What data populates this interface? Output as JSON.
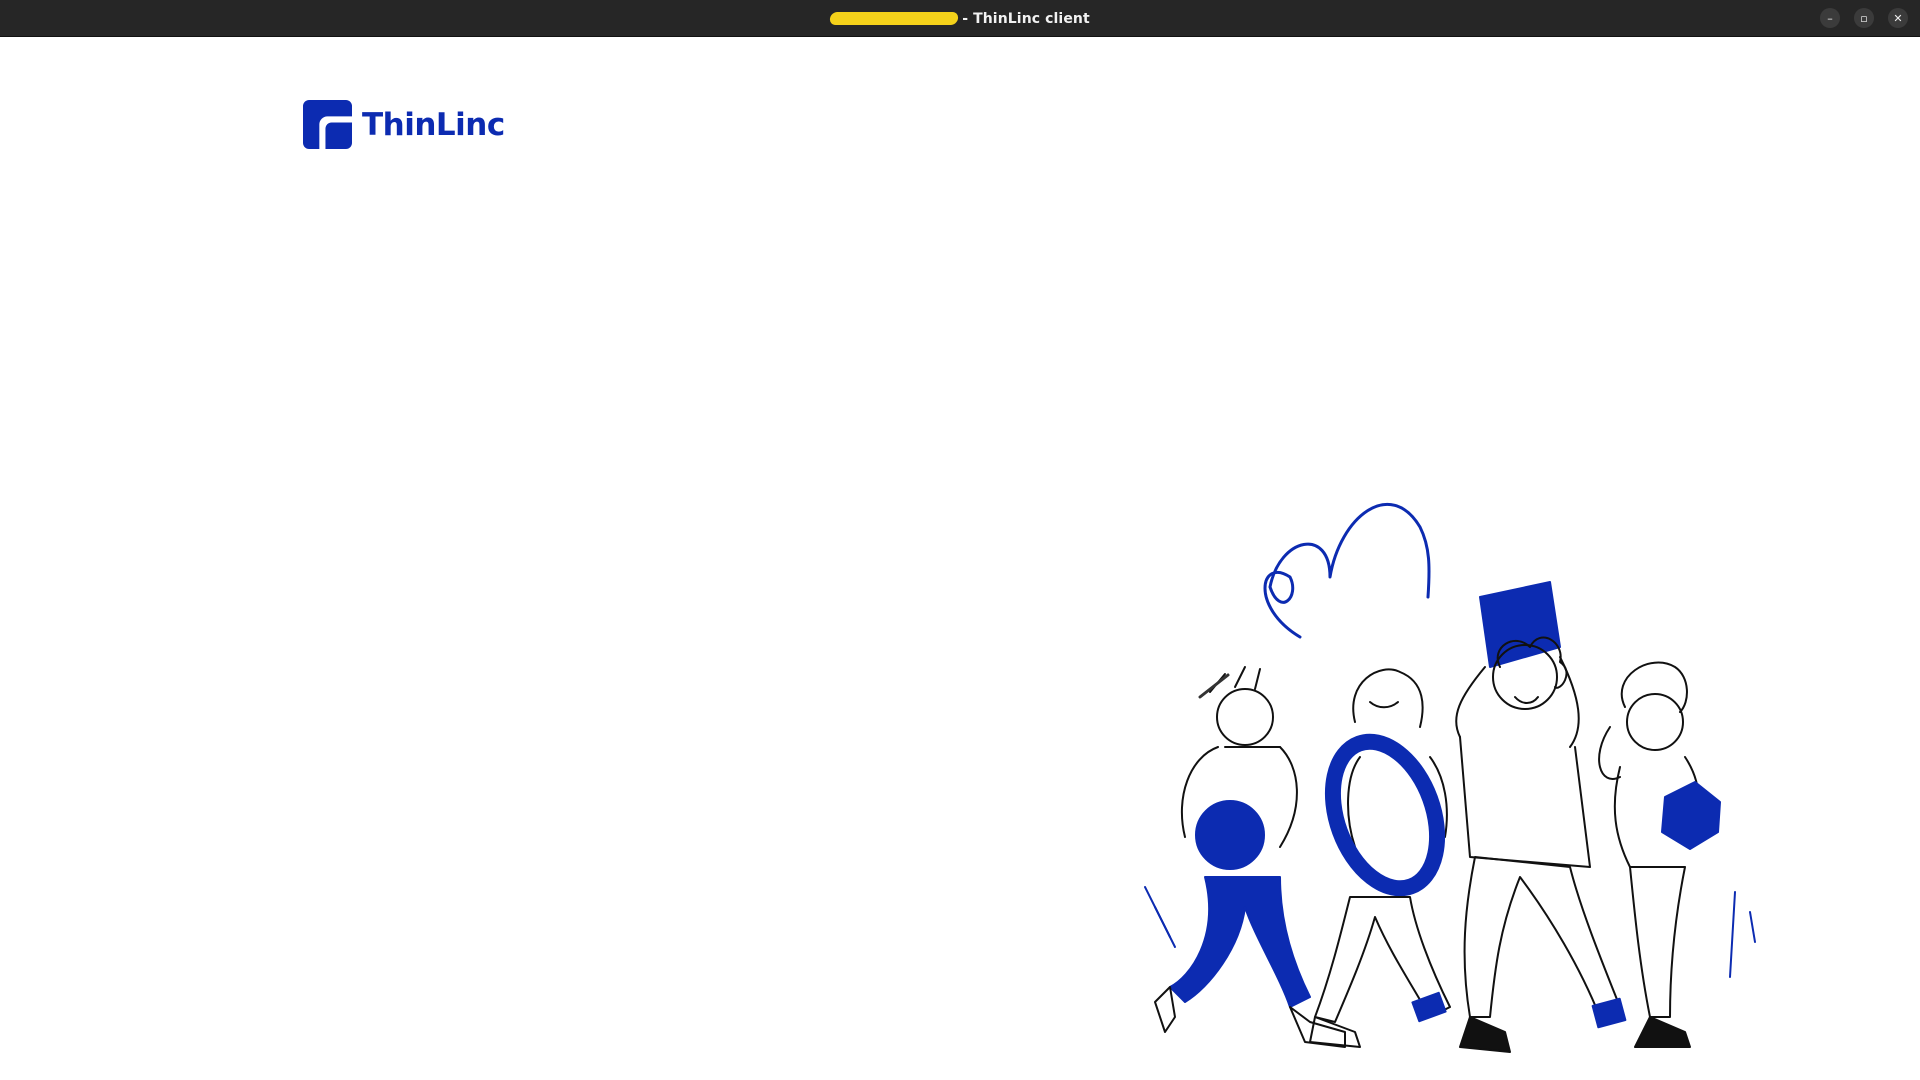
{
  "window": {
    "title": "- ThinLinc client",
    "controls": {
      "minimize_glyph": "–",
      "maximize_glyph": "▫",
      "close_glyph": "✕"
    }
  },
  "brand": {
    "logo_text": "ThinLinc",
    "accent_color": "#0c2bb1"
  },
  "illustration": {
    "icon": "people-carrying-shapes-illustration"
  }
}
